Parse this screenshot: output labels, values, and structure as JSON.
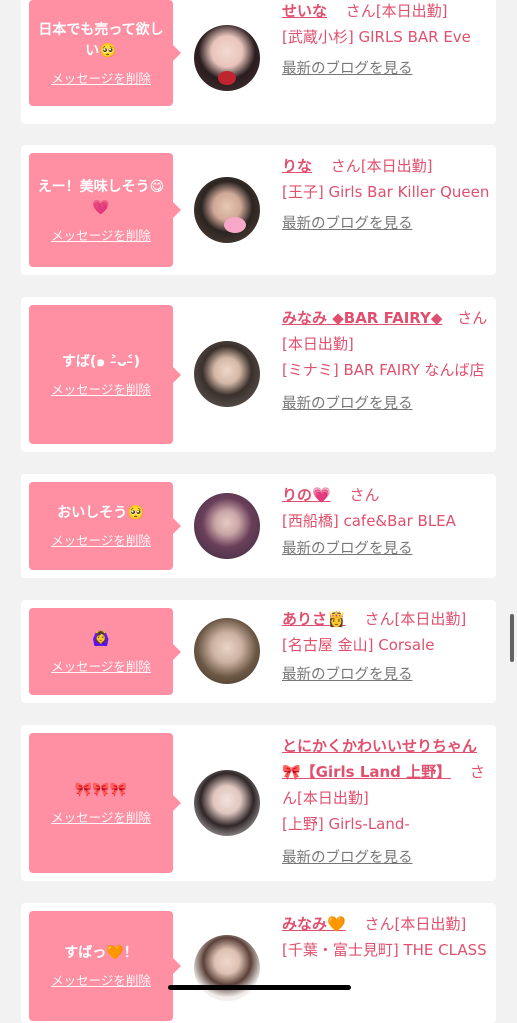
{
  "delete_label": "メッセージを削除",
  "san": "さん",
  "blog_link": "最新のブログを見る",
  "colors": {
    "bubble": "#ff8fa3",
    "accent": "#e0506e",
    "background": "#f2f2f2"
  },
  "cards": [
    {
      "message": "日本でも売って欲しい🥺",
      "name": "せいな",
      "status": "[本日出勤]",
      "shop": "[武蔵小杉] GIRLS BAR Eve"
    },
    {
      "message": "えー！美味しそう😋💗",
      "name": "りな",
      "status": "[本日出勤]",
      "shop": "[王子] Girls Bar Killer Queen"
    },
    {
      "message": "すば(๑ ˃̵ᴗ˂̵)",
      "name": "みなみ ◆BAR FAIRY◆",
      "status": "[本日出勤]",
      "shop": "[ミナミ] BAR FAIRY なんば店"
    },
    {
      "message": "おいしそう🥺",
      "name": "りの💗",
      "status": "",
      "shop": "[西船橋] cafe&Bar BLEA"
    },
    {
      "message": "🙆‍♀️",
      "name": "ありさ👸",
      "status": "[本日出勤]",
      "shop": "[名古屋 金山] Corsale"
    },
    {
      "message": "🎀🎀🎀",
      "name": "とにかくかわいいせりちゃん🎀【Girls Land 上野】",
      "status": "[本日出勤]",
      "shop": "[上野] Girls-Land-"
    },
    {
      "message": "すばっ🧡！",
      "name": "みなみ🧡",
      "status": "[本日出勤]",
      "shop": "[千葉・富士見町] THE CLASS"
    }
  ]
}
